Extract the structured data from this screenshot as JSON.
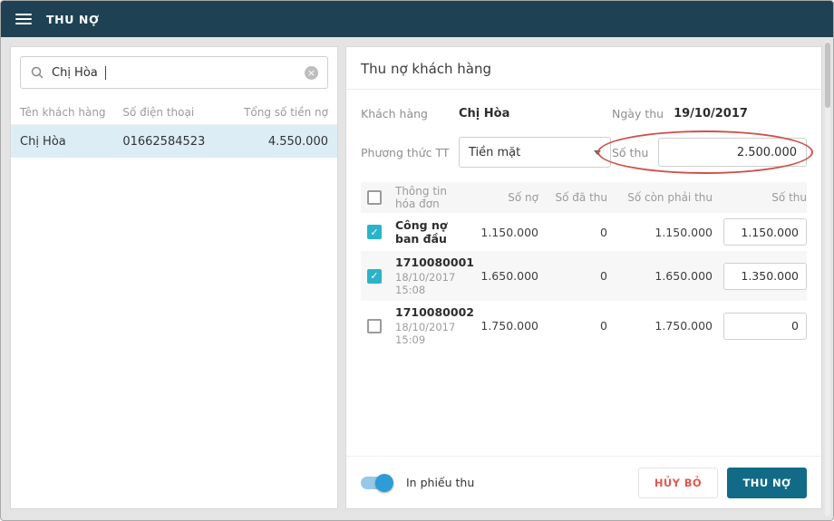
{
  "topbar": {
    "title": "THU NỢ"
  },
  "search": {
    "value": "Chị Hòa"
  },
  "customer_table": {
    "headers": [
      "Tên khách hàng",
      "Số điện thoại",
      "Tổng số tiền nợ"
    ],
    "rows": [
      {
        "name": "Chị Hòa",
        "phone": "01662584523",
        "debt": "4.550.000"
      }
    ]
  },
  "detail": {
    "title": "Thu nợ khách hàng",
    "customer_label": "Khách hàng",
    "customer_value": "Chị Hòa",
    "date_label": "Ngày thu",
    "date_value": "19/10/2017",
    "payment_label": "Phương thức TT",
    "payment_value": "Tiền mặt",
    "amount_label": "Số thu",
    "amount_value": "2.500.000",
    "invoice_table": {
      "headers": [
        "Thông tin hóa đơn",
        "Số nợ",
        "Số đã thu",
        "Số còn phải thu",
        "Số thu"
      ],
      "rows": [
        {
          "checked": true,
          "title": "Công nợ ban đầu",
          "subtitle": "",
          "debt": "1.150.000",
          "paid": "0",
          "remaining": "1.150.000",
          "collect": "1.150.000"
        },
        {
          "checked": true,
          "title": "1710080001",
          "subtitle": "18/10/2017 15:08",
          "debt": "1.650.000",
          "paid": "0",
          "remaining": "1.650.000",
          "collect": "1.350.000"
        },
        {
          "checked": false,
          "title": "1710080002",
          "subtitle": "18/10/2017 15:09",
          "debt": "1.750.000",
          "paid": "0",
          "remaining": "1.750.000",
          "collect": "0"
        }
      ]
    },
    "footer": {
      "print_toggle_label": "In phiếu thu",
      "print_toggle_on": true,
      "cancel_label": "HỦY BỎ",
      "submit_label": "THU NỢ"
    }
  },
  "colors": {
    "topbar": "#1e4253",
    "submit_button": "#116b86",
    "checkbox_checked": "#2bb3c9",
    "selected_row": "#dcedf6",
    "annotation": "#d14f4a",
    "toggle_on": "#2e9cd6",
    "cancel_text": "#e25750"
  }
}
